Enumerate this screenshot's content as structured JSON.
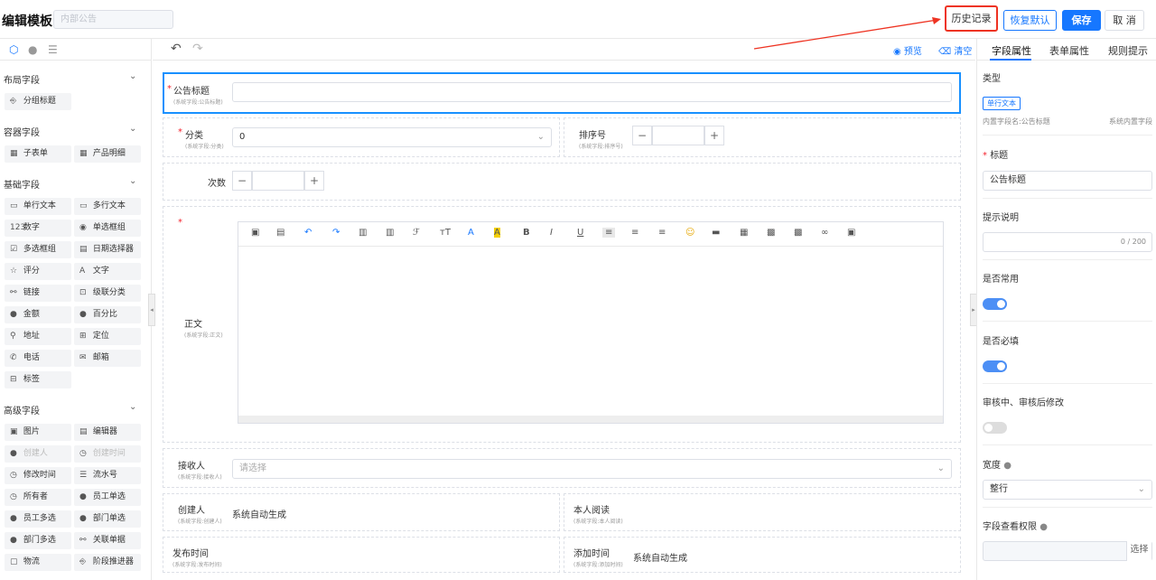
{
  "header": {
    "title": "编辑模板",
    "category": "内部公告",
    "history": "历史记录",
    "reset": "恢复默认",
    "save": "保存",
    "cancel": "取 消"
  },
  "left": {
    "groups": [
      {
        "title": "布局字段",
        "items": [
          {
            "icon": "⎆",
            "label": "分组标题"
          }
        ]
      },
      {
        "title": "容器字段",
        "items": [
          {
            "icon": "▦",
            "label": "子表单"
          },
          {
            "icon": "▦",
            "label": "产品明细"
          }
        ]
      },
      {
        "title": "基础字段",
        "items": [
          {
            "icon": "▭",
            "label": "单行文本"
          },
          {
            "icon": "▭",
            "label": "多行文本"
          },
          {
            "icon": "123",
            "label": "数字"
          },
          {
            "icon": "◉",
            "label": "单选框组"
          },
          {
            "icon": "☑",
            "label": "多选框组"
          },
          {
            "icon": "▤",
            "label": "日期选择器"
          },
          {
            "icon": "☆",
            "label": "评分"
          },
          {
            "icon": "A",
            "label": "文字"
          },
          {
            "icon": "⚯",
            "label": "链接"
          },
          {
            "icon": "⊡",
            "label": "级联分类"
          },
          {
            "icon": "●",
            "label": "金额"
          },
          {
            "icon": "●",
            "label": "百分比"
          },
          {
            "icon": "⚲",
            "label": "地址"
          },
          {
            "icon": "⊞",
            "label": "定位"
          },
          {
            "icon": "✆",
            "label": "电话"
          },
          {
            "icon": "✉",
            "label": "邮箱"
          },
          {
            "icon": "⊟",
            "label": "标签"
          }
        ]
      },
      {
        "title": "高级字段",
        "items": [
          {
            "icon": "▣",
            "label": "图片"
          },
          {
            "icon": "▤",
            "label": "编辑器"
          },
          {
            "icon": "●",
            "label": "创建人",
            "disabled": true
          },
          {
            "icon": "◷",
            "label": "创建时间",
            "disabled": true
          },
          {
            "icon": "◷",
            "label": "修改时间"
          },
          {
            "icon": "☰",
            "label": "流水号"
          },
          {
            "icon": "◷",
            "label": "所有者"
          },
          {
            "icon": "●",
            "label": "员工单选"
          },
          {
            "icon": "●",
            "label": "员工多选"
          },
          {
            "icon": "●",
            "label": "部门单选"
          },
          {
            "icon": "●",
            "label": "部门多选"
          },
          {
            "icon": "⚯",
            "label": "关联单据"
          },
          {
            "icon": "▢",
            "label": "物流"
          },
          {
            "icon": "⎆",
            "label": "阶段推进器"
          }
        ]
      }
    ]
  },
  "center": {
    "preview": "预览",
    "clear": "清空",
    "f_title": {
      "label": "公告标题",
      "sub": "(系统字段:公告标题)"
    },
    "f_cat": {
      "label": "分类",
      "sub": "(系统字段:分类)",
      "value": "0"
    },
    "f_sort": {
      "label": "排序号",
      "sub": "(系统字段:排序号)"
    },
    "f_count": {
      "label": "次数"
    },
    "f_body": {
      "label": "正文",
      "sub": "(系统字段:正文)"
    },
    "f_recv": {
      "label": "接收人",
      "sub": "(系统字段:接收人)",
      "placeholder": "请选择"
    },
    "f_creator": {
      "label": "创建人",
      "sub": "(系统字段:创建人)",
      "value": "系统自动生成"
    },
    "f_read": {
      "label": "本人阅读",
      "sub": "(系统字段:本人阅读)"
    },
    "f_pub": {
      "label": "发布时间",
      "sub": "(系统字段:发布时间)"
    },
    "f_added": {
      "label": "添加时间",
      "sub": "(系统字段:添加时间)",
      "value": "系统自动生成"
    }
  },
  "right": {
    "tabs": [
      "字段属性",
      "表单属性",
      "规则提示"
    ],
    "type_label": "类型",
    "type_value": "单行文本",
    "inner_name": "内置字段名:公告标题",
    "inner_type": "系统内置字段",
    "title_label": "标题",
    "title_value": "公告标题",
    "hint_label": "提示说明",
    "hint_count": "0 / 200",
    "common_label": "是否常用",
    "required_label": "是否必填",
    "review_label": "审核中、审核后修改",
    "width_label": "宽度",
    "width_value": "整行",
    "perm_label": "字段查看权限",
    "perm_btn": "选择",
    "toggles": {
      "common": true,
      "required": true,
      "review": false
    }
  }
}
